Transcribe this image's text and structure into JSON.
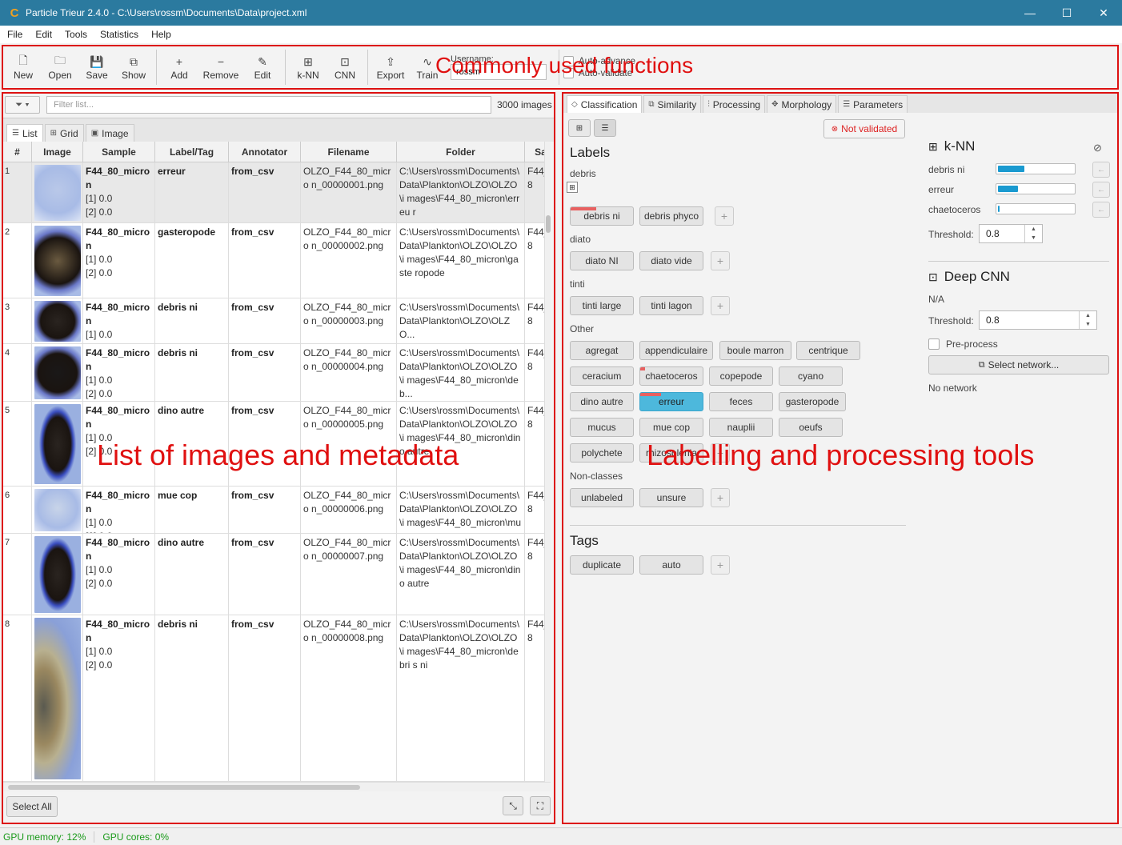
{
  "window": {
    "title": "Particle Trieur 2.4.0 - C:\\Users\\rossm\\Documents\\Data\\project.xml",
    "minimize": "—",
    "maximize": "☐",
    "close": "✕"
  },
  "menu": [
    "File",
    "Edit",
    "Tools",
    "Statistics",
    "Help"
  ],
  "toolbar": {
    "buttons": [
      {
        "label": "New",
        "icon": "new-file-icon",
        "glyph": "🗋"
      },
      {
        "label": "Open",
        "icon": "folder-icon",
        "glyph": "🗀"
      },
      {
        "label": "Save",
        "icon": "save-icon",
        "glyph": "💾"
      },
      {
        "label": "Show",
        "icon": "external-link-icon",
        "glyph": "⧉"
      },
      {
        "label": "Add",
        "icon": "plus-icon",
        "glyph": "+"
      },
      {
        "label": "Remove",
        "icon": "minus-icon",
        "glyph": "−"
      },
      {
        "label": "Edit",
        "icon": "pencil-icon",
        "glyph": "✎"
      },
      {
        "label": "k-NN",
        "icon": "grid-icon",
        "glyph": "⊞"
      },
      {
        "label": "CNN",
        "icon": "chip-icon",
        "glyph": "⊡"
      },
      {
        "label": "Export",
        "icon": "upload-icon",
        "glyph": "⇪"
      },
      {
        "label": "Train",
        "icon": "pulse-icon",
        "glyph": "∿"
      }
    ],
    "username_label": "Username:",
    "username_value": "rossm",
    "auto_advance": "Auto-advance",
    "auto_validate": "Auto-validate"
  },
  "annotations": {
    "toolbar": "Commonly used functions",
    "list": "List of images and metadata",
    "tools": "Labelling and processing tools"
  },
  "left": {
    "filter_placeholder": "Filter list...",
    "image_count": "3000 images",
    "view_tabs": [
      "List",
      "Grid",
      "Image"
    ],
    "columns": [
      "#",
      "Image",
      "Sample",
      "Label/Tag",
      "Annotator",
      "Filename",
      "Folder",
      "Sa"
    ],
    "rows": [
      {
        "n": "1",
        "sample": "F44_80_micron",
        "v1": "[1] 0.0",
        "v2": "[2] 0.0",
        "label": "erreur",
        "annotator": "from_csv",
        "filename": "OLZO_F44_80_micro n_00000001.png",
        "folder": "C:\\Users\\rossm\\Documents\\ Data\\Plankton\\OLZO\\OLZO\\i mages\\F44_80_micron\\erreu r",
        "sa": "F44_8",
        "thumb": "#b9c8e8"
      },
      {
        "n": "2",
        "sample": "F44_80_micron",
        "v1": "[1] 0.0",
        "v2": "[2] 0.0",
        "label": "gasteropode",
        "annotator": "from_csv",
        "filename": "OLZO_F44_80_micro n_00000002.png",
        "folder": "C:\\Users\\rossm\\Documents\\ Data\\Plankton\\OLZO\\OLZO\\i mages\\F44_80_micron\\gaste ropode",
        "sa": "F44_8",
        "thumb": "#6a5a40"
      },
      {
        "n": "3",
        "sample": "F44_80_micron",
        "v1": "[1] 0.0",
        "v2": "[2] 0.0",
        "label": "debris ni",
        "annotator": "from_csv",
        "filename": "OLZO_F44_80_micro n_00000003.png",
        "folder": "C:\\Users\\rossm\\Documents\\ Data\\Plankton\\OLZO\\OLZO...",
        "sa": "F44_8",
        "thumb": "#2a2420"
      },
      {
        "n": "4",
        "sample": "F44_80_micron",
        "v1": "[1] 0.0",
        "v2": "[2] 0.0",
        "label": "debris ni",
        "annotator": "from_csv",
        "filename": "OLZO_F44_80_micro n_00000004.png",
        "folder": "C:\\Users\\rossm\\Documents\\ Data\\Plankton\\OLZO\\OLZO\\i mages\\F44_80_micron\\deb...",
        "sa": "F44_8",
        "thumb": "#1a1818"
      },
      {
        "n": "5",
        "sample": "F44_80_micron",
        "v1": "[1] 0.0",
        "v2": "[2] 0.0",
        "label": "dino autre",
        "annotator": "from_csv",
        "filename": "OLZO_F44_80_micro n_00000005.png",
        "folder": "C:\\Users\\rossm\\Documents\\ Data\\Plankton\\OLZO\\OLZO\\i mages\\F44_80_micron\\dino autre",
        "sa": "F44_8",
        "thumb": "#2a2420"
      },
      {
        "n": "6",
        "sample": "F44_80_micron",
        "v1": "[1] 0.0",
        "v2": "[2] 0.0",
        "label": "mue cop",
        "annotator": "from_csv",
        "filename": "OLZO_F44_80_micro n_00000006.png",
        "folder": "C:\\Users\\rossm\\Documents\\ Data\\Plankton\\OLZO\\OLZO\\i mages\\F44_80_micron\\mue...",
        "sa": "F44_8",
        "thumb": "#c8d4e8"
      },
      {
        "n": "7",
        "sample": "F44_80_micron",
        "v1": "[1] 0.0",
        "v2": "[2] 0.0",
        "label": "dino autre",
        "annotator": "from_csv",
        "filename": "OLZO_F44_80_micro n_00000007.png",
        "folder": "C:\\Users\\rossm\\Documents\\ Data\\Plankton\\OLZO\\OLZO\\i mages\\F44_80_micron\\dino autre",
        "sa": "F44_8",
        "thumb": "#2a2420"
      },
      {
        "n": "8",
        "sample": "F44_80_micron",
        "v1": "[1] 0.0",
        "v2": "[2] 0.0",
        "label": "debris ni",
        "annotator": "from_csv",
        "filename": "OLZO_F44_80_micro n_00000008.png",
        "folder": "C:\\Users\\rossm\\Documents\\ Data\\Plankton\\OLZO\\OLZO\\i mages\\F44_80_micron\\debri s ni",
        "sa": "F44_8",
        "thumb": "#7a6a50"
      }
    ],
    "select_all": "Select All"
  },
  "right": {
    "tabs": [
      "Classification",
      "Similarity",
      "Processing",
      "Morphology",
      "Parameters"
    ],
    "not_validated": "Not validated",
    "labels_title": "Labels",
    "groups": {
      "debris": "debris",
      "diato": "diato",
      "tinti": "tinti",
      "other": "Other",
      "nonclasses": "Non-classes"
    },
    "labels": {
      "debris_ni": "debris ni",
      "debris_phyco": "debris phyco",
      "diato_ni": "diato NI",
      "diato_vide": "diato vide",
      "tinti_large": "tinti large",
      "tinti_lagon": "tinti lagon",
      "agregat": "agregat",
      "appendiculaire": "appendiculaire",
      "boule_marron": "boule marron",
      "centrique": "centrique",
      "ceracium": "ceracium",
      "chaetoceros": "chaetoceros",
      "copepode": "copepode",
      "cyano": "cyano",
      "dino_autre": "dino autre",
      "erreur": "erreur",
      "feces": "feces",
      "gasteropode": "gasteropode",
      "mucus": "mucus",
      "mue_cop": "mue cop",
      "nauplii": "nauplii",
      "oeufs": "oeufs",
      "polychete": "polychete",
      "rhizosolenia": "rhizosolenia",
      "unlabeled": "unlabeled",
      "unsure": "unsure"
    },
    "tags_title": "Tags",
    "tags": {
      "duplicate": "duplicate",
      "auto": "auto"
    },
    "knn": {
      "title": "k-NN",
      "rows": [
        {
          "name": "debris ni",
          "value": 0.34
        },
        {
          "name": "erreur",
          "value": 0.26
        },
        {
          "name": "chaetoceros",
          "value": 0.02
        }
      ],
      "threshold_label": "Threshold:",
      "threshold": "0.8"
    },
    "cnn": {
      "title": "Deep CNN",
      "status": "N/A",
      "threshold_label": "Threshold:",
      "threshold": "0.8",
      "preprocess": "Pre-process",
      "select_network": "Select network...",
      "no_network": "No network"
    }
  },
  "status": {
    "gpu_memory": "GPU memory: 12%",
    "gpu_cores": "GPU cores: 0%"
  },
  "colors": {
    "titlebar": "#2b7a9f",
    "accent": "#4db8dc",
    "annotation": "#e01010",
    "knn_bar": "#1a9ad0"
  }
}
